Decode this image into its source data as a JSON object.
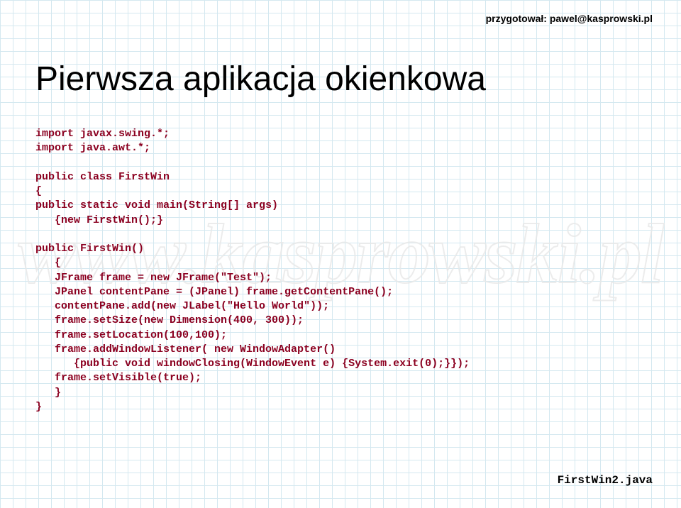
{
  "header": {
    "credit": "przygotował: pawel@kasprowski.pl"
  },
  "watermark": "www.kasprowski.pl",
  "title": "Pierwsza aplikacja okienkowa",
  "code": {
    "l01": "import javax.swing.*;",
    "l02": "import java.awt.*;",
    "l03": "",
    "l04": "public class FirstWin",
    "l05": "{",
    "l06": "public static void main(String[] args)",
    "l07": "   {new FirstWin();}",
    "l08": "",
    "l09": "public FirstWin()",
    "l10": "   {",
    "l11": "   JFrame frame = new JFrame(\"Test\");",
    "l12": "   JPanel contentPane = (JPanel) frame.getContentPane();",
    "l13": "   contentPane.add(new JLabel(\"Hello World\"));",
    "l14": "   frame.setSize(new Dimension(400, 300));",
    "l15": "   frame.setLocation(100,100);",
    "l16": "   frame.addWindowListener( new WindowAdapter()",
    "l17": "      {public void windowClosing(WindowEvent e) {System.exit(0);}});",
    "l18": "   frame.setVisible(true);",
    "l19": "   }",
    "l20": "}"
  },
  "footer": {
    "filename": "FirstWin2.java"
  }
}
